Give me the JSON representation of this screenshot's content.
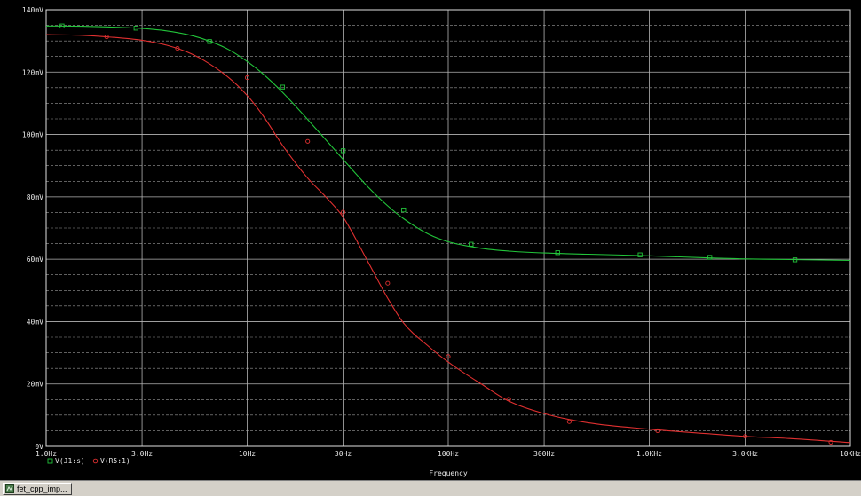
{
  "window": {
    "document_tab": "fet_cpp_imp..."
  },
  "chart_data": {
    "type": "line",
    "xscale": "log",
    "xlim": [
      1,
      10000
    ],
    "ylim": [
      0,
      140
    ],
    "xlabel": "Frequency",
    "ylabel": "",
    "x_ticks": [
      1,
      3,
      10,
      30,
      100,
      300,
      1000,
      3000,
      10000
    ],
    "x_tick_labels": [
      "1.0Hz",
      "3.0Hz",
      "10Hz",
      "30Hz",
      "100Hz",
      "300Hz",
      "1.0KHz",
      "3.0KHz",
      "10KHz"
    ],
    "y_ticks": [
      0,
      20,
      40,
      60,
      80,
      100,
      120,
      140
    ],
    "y_tick_labels": [
      "0V",
      "20mV",
      "40mV",
      "60mV",
      "80mV",
      "100mV",
      "120mV",
      "140mV"
    ],
    "grid": true,
    "legend": "bottom-left",
    "background": "#000000",
    "series": [
      {
        "name": "V(J1:s)",
        "color": "#22c43a",
        "marker": "square",
        "x": [
          1,
          1.5,
          2,
          3,
          4,
          5,
          6,
          8,
          10,
          12,
          15,
          20,
          25,
          30,
          40,
          50,
          60,
          80,
          100,
          150,
          200,
          300,
          500,
          1000,
          2000,
          3000,
          5000,
          10000
        ],
        "values": [
          134.8,
          134.7,
          134.5,
          134.0,
          133.2,
          132.1,
          130.7,
          127.4,
          123.4,
          119.4,
          113.5,
          104.8,
          97.8,
          92.0,
          83.1,
          77.1,
          73.0,
          68.0,
          65.6,
          63.4,
          62.6,
          62.0,
          61.6,
          61.1,
          60.4,
          60.1,
          59.9,
          59.6
        ],
        "marker_x": [
          1.2,
          2.8,
          6.5,
          15,
          30,
          60,
          130,
          350,
          900,
          2000,
          5300
        ],
        "marker_values": [
          134.8,
          134.1,
          129.8,
          115.2,
          94.8,
          75.8,
          64.8,
          62.1,
          61.4,
          60.6,
          59.8
        ]
      },
      {
        "name": "V(R5:1)",
        "color": "#e03030",
        "marker": "circle",
        "x": [
          1,
          1.5,
          2,
          3,
          4,
          5,
          6,
          8,
          10,
          12,
          15,
          20,
          25,
          30,
          40,
          50,
          60,
          80,
          100,
          150,
          200,
          300,
          500,
          1000,
          2000,
          3000,
          5000,
          10000
        ],
        "values": [
          132.0,
          131.8,
          131.3,
          130.2,
          128.6,
          126.5,
          124.0,
          118.5,
          112.5,
          106.0,
          96.5,
          86.0,
          79.5,
          73.5,
          59.0,
          47.5,
          39.5,
          32.0,
          27.0,
          19.5,
          14.5,
          10.5,
          7.5,
          5.5,
          4.0,
          3.2,
          2.5,
          1.2
        ],
        "marker_x": [
          2,
          4.5,
          10,
          20,
          30,
          50,
          100,
          200,
          400,
          1100,
          3000,
          8000
        ],
        "marker_values": [
          131.3,
          127.6,
          118.2,
          97.8,
          75.1,
          52.3,
          28.8,
          15.1,
          7.9,
          5.0,
          3.2,
          1.3
        ]
      }
    ]
  }
}
